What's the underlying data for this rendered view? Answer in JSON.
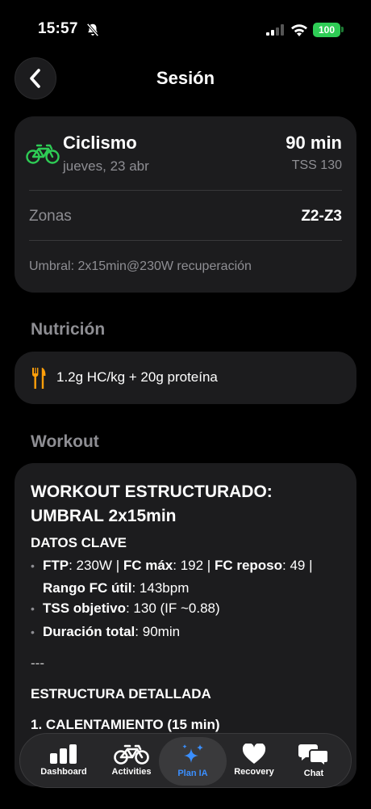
{
  "status": {
    "time": "15:57",
    "battery": "100"
  },
  "header": {
    "title": "Sesión"
  },
  "session": {
    "sport": "Ciclismo",
    "date": "jueves, 23 abr",
    "duration": "90 min",
    "tss": "TSS 130",
    "zones_label": "Zonas",
    "zones_value": "Z2-Z3",
    "description": "Umbral: 2x15min@230W recuperación"
  },
  "nutrition": {
    "section_title": "Nutrición",
    "text": "1.2g HC/kg + 20g proteína"
  },
  "workout": {
    "section_title": "Workout",
    "title_line1": "WORKOUT ESTRUCTURADO:",
    "title_line2": "UMBRAL 2x15min",
    "key_data_heading": "DATOS CLAVE",
    "ftp_label": "FTP",
    "ftp_value": ": 230W | ",
    "fc_max_label": "FC máx",
    "fc_max_value": ": 192 | ",
    "fc_rest_label": "FC reposo",
    "fc_rest_value": ": 49 |",
    "fc_range_label": "Rango FC útil",
    "fc_range_value": ": 143bpm",
    "tss_label": "TSS objetivo",
    "tss_value": ": 130 (IF ~0.88)",
    "duration_label": "Duración total",
    "duration_value": ": 90min",
    "separator": "---",
    "structure_heading": "ESTRUCTURA DETALLADA",
    "step1": "1. CALENTAMIENTO (15 min)"
  },
  "tabs": [
    {
      "label": "Dashboard"
    },
    {
      "label": "Activities"
    },
    {
      "label": "Plan IA"
    },
    {
      "label": "Recovery"
    },
    {
      "label": "Chat"
    }
  ],
  "colors": {
    "accent_green": "#2ecc55",
    "accent_blue": "#3a8fff",
    "card": "#1c1c1e",
    "secondary_text": "#8e8e93"
  },
  "icons": [
    "bell-slash-icon",
    "signal-icon",
    "wifi-icon",
    "battery-icon",
    "chevron-left-icon",
    "bicycle-icon",
    "fork-knife-icon",
    "bar-chart-icon",
    "sparkles-icon",
    "heart-icon",
    "chat-bubbles-icon"
  ]
}
